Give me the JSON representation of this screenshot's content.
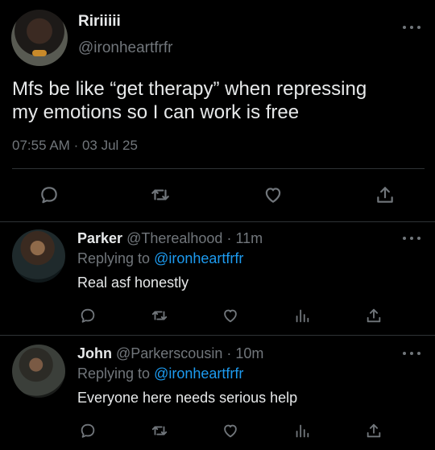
{
  "tweet": {
    "display_name": "Ririiiii",
    "handle": "@ironheartfrfr",
    "text_line1": "Mfs be like “get therapy” when repressing",
    "text_line2": "my emotions so I can work is free",
    "time": "07:55 AM",
    "dot": "·",
    "date": "03 Jul 25"
  },
  "replies": [
    {
      "display_name": "Parker",
      "handle": "@Therealhood",
      "time": "· 11m",
      "replying_label": "Replying to",
      "replying_to": "@ironheartfrfr",
      "text": "Real asf honestly"
    },
    {
      "display_name": "John",
      "handle": "@Parkerscousin",
      "time": "· 10m",
      "replying_label": "Replying to",
      "replying_to": "@ironheartfrfr",
      "text": "Everyone here needs serious help"
    }
  ],
  "icons": {
    "reply": "reply-icon",
    "retweet": "retweet-icon",
    "like": "like-icon",
    "share": "share-icon",
    "views": "views-icon",
    "more": "more-icon"
  },
  "colors": {
    "background": "#000000",
    "text": "#e7e9ea",
    "muted": "#71767b",
    "link": "#1d9bf0",
    "divider": "#2f3336"
  }
}
